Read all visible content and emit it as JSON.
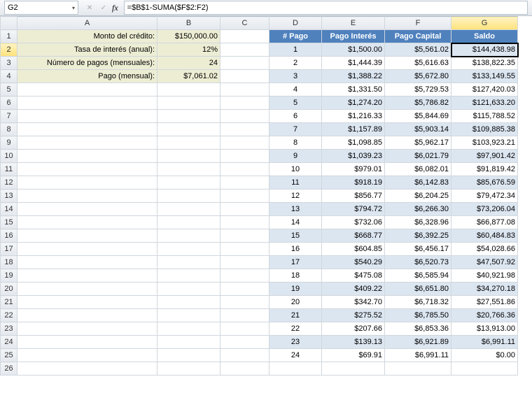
{
  "formula_bar": {
    "cell_ref": "G2",
    "fx_label": "fx",
    "formula": "=$B$1-SUMA($F$2:F2)"
  },
  "symbols": {
    "dropdown": "▾",
    "cancel": "✕",
    "confirm": "✓"
  },
  "columns": [
    "A",
    "B",
    "C",
    "D",
    "E",
    "F",
    "G"
  ],
  "row_count": 26,
  "left_labels": {
    "r1": {
      "label": "Monto del crédito:",
      "value": "$150,000.00"
    },
    "r2": {
      "label": "Tasa de interés (anual):",
      "value": "12%"
    },
    "r3": {
      "label": "Número de pagos (mensuales):",
      "value": "24"
    },
    "r4": {
      "label": "Pago (mensual):",
      "value": "$7,061.02"
    }
  },
  "amort_headers": {
    "D": "# Pago",
    "E": "Pago Interés",
    "F": "Pago Capital",
    "G": "Saldo"
  },
  "amort_rows": [
    {
      "n": "1",
      "i": "$1,500.00",
      "c": "$5,561.02",
      "s": "$144,438.98"
    },
    {
      "n": "2",
      "i": "$1,444.39",
      "c": "$5,616.63",
      "s": "$138,822.35"
    },
    {
      "n": "3",
      "i": "$1,388.22",
      "c": "$5,672.80",
      "s": "$133,149.55"
    },
    {
      "n": "4",
      "i": "$1,331.50",
      "c": "$5,729.53",
      "s": "$127,420.03"
    },
    {
      "n": "5",
      "i": "$1,274.20",
      "c": "$5,786.82",
      "s": "$121,633.20"
    },
    {
      "n": "6",
      "i": "$1,216.33",
      "c": "$5,844.69",
      "s": "$115,788.52"
    },
    {
      "n": "7",
      "i": "$1,157.89",
      "c": "$5,903.14",
      "s": "$109,885.38"
    },
    {
      "n": "8",
      "i": "$1,098.85",
      "c": "$5,962.17",
      "s": "$103,923.21"
    },
    {
      "n": "9",
      "i": "$1,039.23",
      "c": "$6,021.79",
      "s": "$97,901.42"
    },
    {
      "n": "10",
      "i": "$979.01",
      "c": "$6,082.01",
      "s": "$91,819.42"
    },
    {
      "n": "11",
      "i": "$918.19",
      "c": "$6,142.83",
      "s": "$85,676.59"
    },
    {
      "n": "12",
      "i": "$856.77",
      "c": "$6,204.25",
      "s": "$79,472.34"
    },
    {
      "n": "13",
      "i": "$794.72",
      "c": "$6,266.30",
      "s": "$73,206.04"
    },
    {
      "n": "14",
      "i": "$732.06",
      "c": "$6,328.96",
      "s": "$66,877.08"
    },
    {
      "n": "15",
      "i": "$668.77",
      "c": "$6,392.25",
      "s": "$60,484.83"
    },
    {
      "n": "16",
      "i": "$604.85",
      "c": "$6,456.17",
      "s": "$54,028.66"
    },
    {
      "n": "17",
      "i": "$540.29",
      "c": "$6,520.73",
      "s": "$47,507.92"
    },
    {
      "n": "18",
      "i": "$475.08",
      "c": "$6,585.94",
      "s": "$40,921.98"
    },
    {
      "n": "19",
      "i": "$409.22",
      "c": "$6,651.80",
      "s": "$34,270.18"
    },
    {
      "n": "20",
      "i": "$342.70",
      "c": "$6,718.32",
      "s": "$27,551.86"
    },
    {
      "n": "21",
      "i": "$275.52",
      "c": "$6,785.50",
      "s": "$20,766.36"
    },
    {
      "n": "22",
      "i": "$207.66",
      "c": "$6,853.36",
      "s": "$13,913.00"
    },
    {
      "n": "23",
      "i": "$139.13",
      "c": "$6,921.89",
      "s": "$6,991.11"
    },
    {
      "n": "24",
      "i": "$69.91",
      "c": "$6,991.11",
      "s": "$0.00"
    }
  ],
  "chart_data": {
    "type": "table",
    "title": "Tabla de amortización",
    "columns": [
      "# Pago",
      "Pago Interés",
      "Pago Capital",
      "Saldo"
    ],
    "rows": [
      [
        1,
        1500.0,
        5561.02,
        144438.98
      ],
      [
        2,
        1444.39,
        5616.63,
        138822.35
      ],
      [
        3,
        1388.22,
        5672.8,
        133149.55
      ],
      [
        4,
        1331.5,
        5729.53,
        127420.03
      ],
      [
        5,
        1274.2,
        5786.82,
        121633.2
      ],
      [
        6,
        1216.33,
        5844.69,
        115788.52
      ],
      [
        7,
        1157.89,
        5903.14,
        109885.38
      ],
      [
        8,
        1098.85,
        5962.17,
        103923.21
      ],
      [
        9,
        1039.23,
        6021.79,
        97901.42
      ],
      [
        10,
        979.01,
        6082.01,
        91819.42
      ],
      [
        11,
        918.19,
        6142.83,
        85676.59
      ],
      [
        12,
        856.77,
        6204.25,
        79472.34
      ],
      [
        13,
        794.72,
        6266.3,
        73206.04
      ],
      [
        14,
        732.06,
        6328.96,
        66877.08
      ],
      [
        15,
        668.77,
        6392.25,
        60484.83
      ],
      [
        16,
        604.85,
        6456.17,
        54028.66
      ],
      [
        17,
        540.29,
        6520.73,
        47507.92
      ],
      [
        18,
        475.08,
        6585.94,
        40921.98
      ],
      [
        19,
        409.22,
        6651.8,
        34270.18
      ],
      [
        20,
        342.7,
        6718.32,
        27551.86
      ],
      [
        21,
        275.52,
        6785.5,
        20766.36
      ],
      [
        22,
        207.66,
        6853.36,
        13913.0
      ],
      [
        23,
        139.13,
        6921.89,
        6991.11
      ],
      [
        24,
        69.91,
        6991.11,
        0.0
      ]
    ]
  }
}
